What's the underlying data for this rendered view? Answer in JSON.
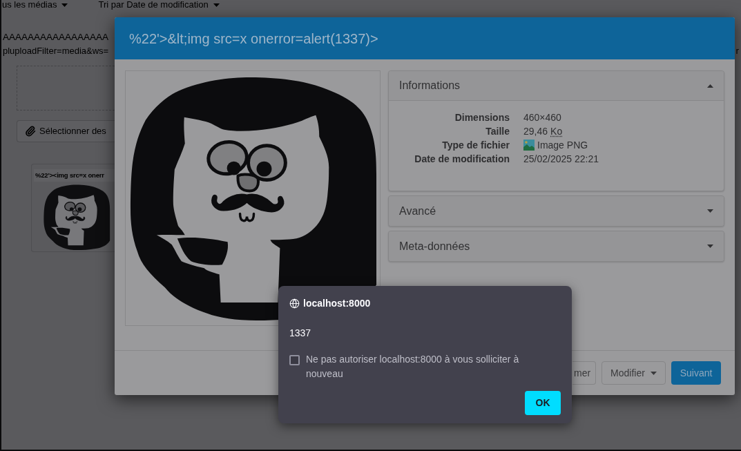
{
  "background_page": {
    "filters": [
      {
        "label": "us les médias"
      },
      {
        "label": "Tri par Date de modification"
      }
    ],
    "url_text": {
      "line_1": "AAAAAAAAAAAAAAAAA",
      "line_2": "pluploadFilter=media&ws=",
      "line_2_right_edge": "r"
    },
    "upload_button": {
      "label": "Sélectionner des"
    },
    "media_card": {
      "title": "%22'><img src=x onerr"
    }
  },
  "modal": {
    "title": "%22'>&lt;img src=x onerror=alert(1337)>",
    "panels": [
      {
        "title": "Informations",
        "expanded": true,
        "rows": [
          {
            "kind": "text",
            "label": "Dimensions",
            "value": "460×460"
          },
          {
            "kind": "size",
            "label": "Taille",
            "value": "29,46",
            "unit": "Ko"
          },
          {
            "kind": "file-type",
            "label": "Type de fichier",
            "value": "Image PNG"
          },
          {
            "kind": "text",
            "label": "Date de modification",
            "value": "25/02/2025 22:21"
          }
        ]
      },
      {
        "title": "Avancé",
        "expanded": false
      },
      {
        "title": "Meta-données",
        "expanded": false
      }
    ],
    "buttons": [
      {
        "kind": "default",
        "label": "mer"
      },
      {
        "kind": "dropdown",
        "label": "Modifier"
      },
      {
        "kind": "primary",
        "label": "Suivant"
      }
    ]
  },
  "alert": {
    "origin": "localhost:8000",
    "message": "1337",
    "checkbox": {
      "label": "Ne pas autoriser localhost:8000 à vous solliciter à nouveau",
      "checked": false
    },
    "button": {
      "label": "OK"
    }
  }
}
